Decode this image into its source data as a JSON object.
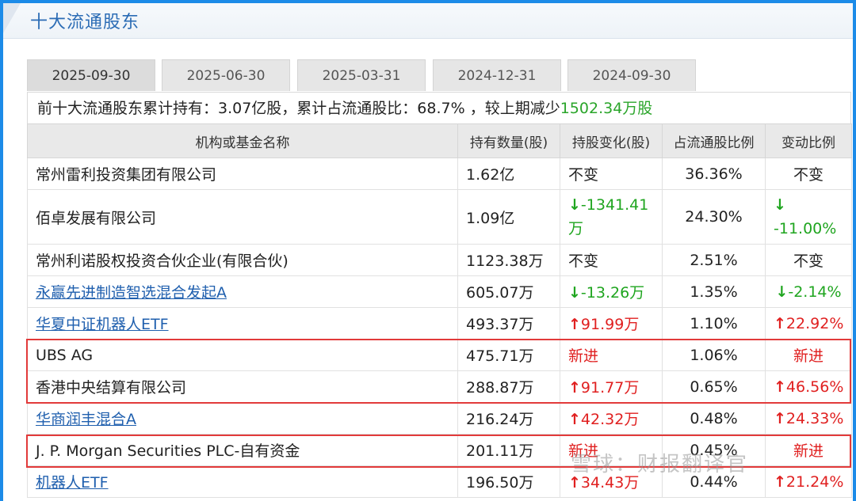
{
  "page": {
    "title": "十大流通股东"
  },
  "tabs": [
    {
      "label": "2025-09-30",
      "active": true
    },
    {
      "label": "2025-06-30",
      "active": false
    },
    {
      "label": "2025-03-31",
      "active": false
    },
    {
      "label": "2024-12-31",
      "active": false
    },
    {
      "label": "2024-09-30",
      "active": false
    }
  ],
  "summary": {
    "text": "前十大流通股东累计持有：3.07亿股，累计占流通股比：68.7% ，较上期减少",
    "highlight": "1502.34万股"
  },
  "table": {
    "headers": [
      "机构或基金名称",
      "持有数量(股)",
      "持股变化(股)",
      "占流通股比例",
      "变动比例"
    ],
    "rows": [
      {
        "name": "常州雷利投资集团有限公司",
        "link": false,
        "qty": "1.62亿",
        "change": "不变",
        "change_dir": "none",
        "ratio": "36.36%",
        "pct": "不变",
        "pct_dir": "none"
      },
      {
        "name": "佰卓发展有限公司",
        "link": false,
        "qty": "1.09亿",
        "change": "-1341.41万",
        "change_dir": "down",
        "ratio": "24.30%",
        "pct": "-11.00%",
        "pct_dir": "down"
      },
      {
        "name": "常州利诺股权投资合伙企业(有限合伙)",
        "link": false,
        "qty": "1123.38万",
        "change": "不变",
        "change_dir": "none",
        "ratio": "2.51%",
        "pct": "不变",
        "pct_dir": "none"
      },
      {
        "name": "永赢先进制造智选混合发起A",
        "link": true,
        "qty": "605.07万",
        "change": "-13.26万",
        "change_dir": "down",
        "ratio": "1.35%",
        "pct": "-2.14%",
        "pct_dir": "down"
      },
      {
        "name": "华夏中证机器人ETF",
        "link": true,
        "qty": "493.37万",
        "change": "91.99万",
        "change_dir": "up",
        "ratio": "1.10%",
        "pct": "22.92%",
        "pct_dir": "up"
      },
      {
        "name": "UBS AG",
        "link": false,
        "qty": "475.71万",
        "change": "新进",
        "change_dir": "new",
        "ratio": "1.06%",
        "pct": "新进",
        "pct_dir": "new"
      },
      {
        "name": "香港中央结算有限公司",
        "link": false,
        "qty": "288.87万",
        "change": "91.77万",
        "change_dir": "up",
        "ratio": "0.65%",
        "pct": "46.56%",
        "pct_dir": "up"
      },
      {
        "name": "华商润丰混合A",
        "link": true,
        "qty": "216.24万",
        "change": "42.32万",
        "change_dir": "up",
        "ratio": "0.48%",
        "pct": "24.33%",
        "pct_dir": "up"
      },
      {
        "name": "J. P. Morgan Securities PLC-自有资金",
        "link": false,
        "qty": "201.11万",
        "change": "新进",
        "change_dir": "new",
        "ratio": "0.45%",
        "pct": "新进",
        "pct_dir": "new"
      },
      {
        "name": "机器人ETF",
        "link": true,
        "qty": "196.50万",
        "change": "34.43万",
        "change_dir": "up",
        "ratio": "0.44%",
        "pct": "21.24%",
        "pct_dir": "up"
      }
    ]
  },
  "watermark": "雪球：财报翻译官",
  "colors": {
    "up": "#e02020",
    "down": "#1fa51f",
    "link": "#1f5fae",
    "highlight_box": "#e23a3a",
    "accent": "#2b6cb5"
  }
}
